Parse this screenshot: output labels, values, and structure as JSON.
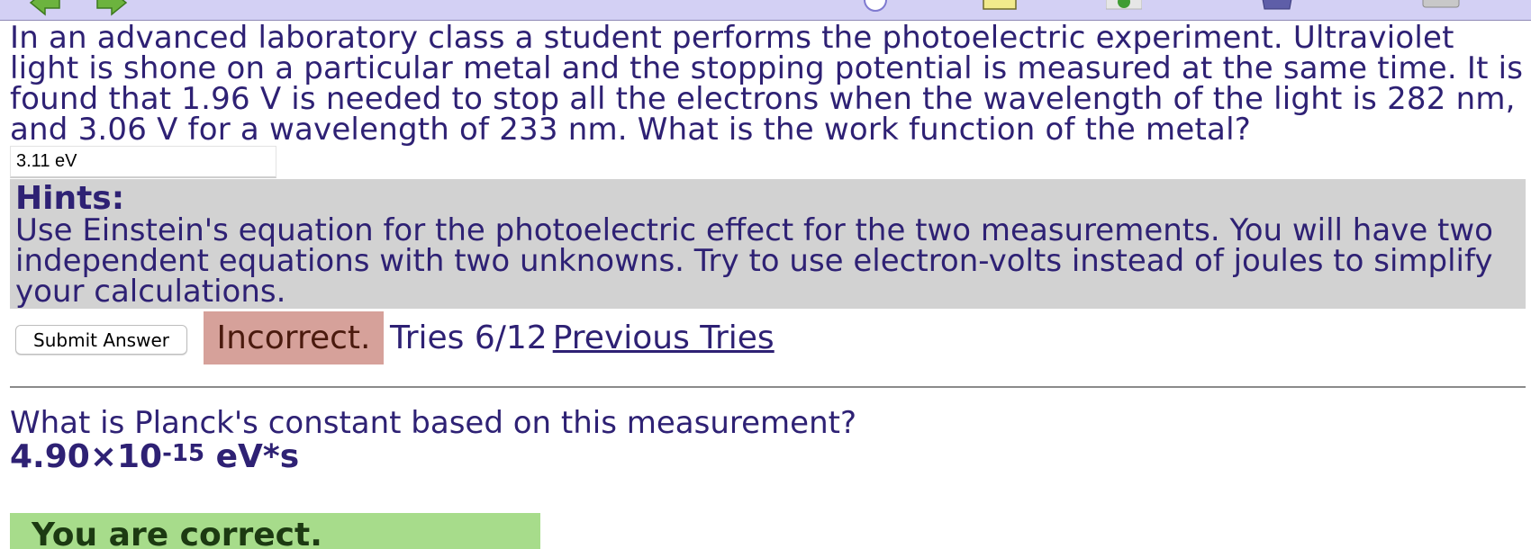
{
  "toolbar": {
    "icons": [
      "back-arrow-icon",
      "forward-arrow-icon",
      "help-circle-icon",
      "notes-icon",
      "gear-icon",
      "bookmark-icon",
      "print-icon"
    ]
  },
  "question": {
    "text": "In an advanced laboratory class a student performs the photoelectric experiment. Ultraviolet light is shone on a particular metal and the stopping potential is measured at the same time. It is found that 1.96 V is needed to stop all the electrons when the wavelength of the light is 282 nm, and 3.06 V for a wavelength of 233 nm. What is the work function of the metal?",
    "answer_value": "3.11 eV"
  },
  "hints": {
    "title": "Hints:",
    "text": "Use Einstein's equation for the photoelectric effect for the two measurements. You will have two independent equations with two unknowns. Try to use electron-volts instead of joules to simplify your calculations."
  },
  "submission": {
    "submit_label": "Submit Answer",
    "status": "Incorrect.",
    "status_color": "#d6a19a",
    "tries_text": "Tries 6/12",
    "previous_tries_label": "Previous Tries"
  },
  "question2": {
    "text": "What is Planck's constant based on this measurement?",
    "answer_mantissa": "4.90×10",
    "answer_exponent": "-15",
    "answer_unit": " eV*s",
    "result": "You are correct.",
    "result_color": "#a7dc8b"
  }
}
